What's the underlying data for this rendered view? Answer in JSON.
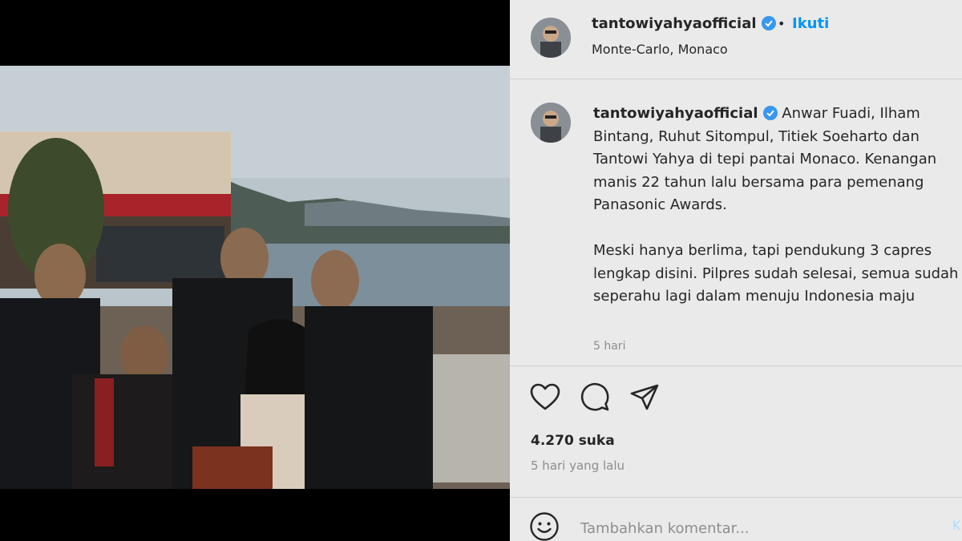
{
  "header": {
    "username": "tantowiyahyaofficial",
    "separator": "•",
    "follow_label": "Ikuti",
    "location": "Monte-Carlo, Monaco"
  },
  "caption": {
    "username": "tantowiyahyaofficial",
    "text": "Anwar Fuadi, Ilham Bintang, Ruhut Sitompul, Titiek Soeharto dan Tantowi Yahya di tepi pantai Monaco. Kenangan manis 22 tahun lalu bersama para pemenang Panasonic Awards.\n\nMeski hanya berlima, tapi pendukung 3 capres lengkap disini. Pilpres sudah selesai, semua sudah seperahu lagi dalam menuju Indonesia maju",
    "time": "5 hari"
  },
  "actions": {
    "like_icon": "heart-icon",
    "comment_icon": "comment-icon",
    "share_icon": "send-icon"
  },
  "stats": {
    "likes": "4.270 suka",
    "posted": "5 hari yang lalu"
  },
  "comment": {
    "placeholder": "Tambahkan komentar...",
    "post_label": "K"
  },
  "colors": {
    "accent": "#0095f6",
    "verified": "#3897f0",
    "panel_bg": "#eaeaea"
  }
}
